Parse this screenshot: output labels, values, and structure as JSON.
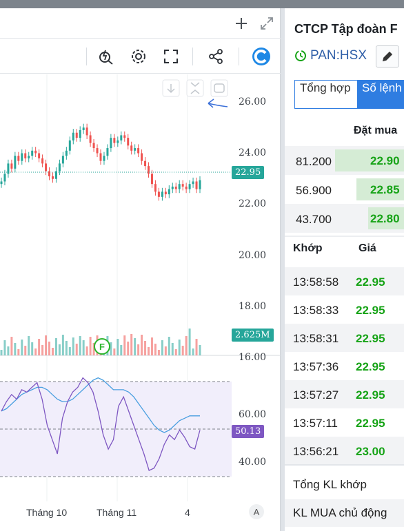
{
  "chart": {
    "y_ticks_price": [
      "26.00",
      "24.00",
      "22.00",
      "20.00",
      "18.00",
      "16.00"
    ],
    "y_ticks_rsi": [
      "60.00",
      "40.00"
    ],
    "x_ticks": [
      "Tháng 10",
      "Tháng 11",
      "4"
    ],
    "last_price_tag": "22.95",
    "volume_tag": "2.625M",
    "rsi_tag": "50.13",
    "event_marker": "F",
    "auto_scale_label": "A",
    "colors": {
      "up": "#26a69a",
      "down": "#ef5350",
      "rsi_line": "#7e57c2",
      "ma_line": "#4a9fe0",
      "rsi_tag": "#7e57c2",
      "price_tag": "#26a69a"
    }
  },
  "panel": {
    "title": "CTCP Tập đoàn F",
    "ticker": "PAN:HSX",
    "tabs": [
      "Tổng hợp",
      "Số lệnh"
    ],
    "bid_header": "Đặt mua",
    "bids": [
      {
        "volume": "81.200",
        "price": "22.90"
      },
      {
        "volume": "56.900",
        "price": "22.85"
      },
      {
        "volume": "43.700",
        "price": "22.80"
      }
    ],
    "trades_header": {
      "time": "Khớp",
      "price": "Giá"
    },
    "trades": [
      {
        "time": "13:58:58",
        "price": "22.95"
      },
      {
        "time": "13:58:33",
        "price": "22.95"
      },
      {
        "time": "13:58:31",
        "price": "22.95"
      },
      {
        "time": "13:57:36",
        "price": "22.95"
      },
      {
        "time": "13:57:27",
        "price": "22.95"
      },
      {
        "time": "13:57:11",
        "price": "22.95"
      },
      {
        "time": "13:56:21",
        "price": "23.00"
      }
    ],
    "summary": [
      "Tổng KL khớp",
      "KL MUA chủ động"
    ],
    "colors": {
      "green": "#16a316",
      "bid_bg": "#d5ecd5",
      "tab_active": "#2f7de1"
    }
  }
}
